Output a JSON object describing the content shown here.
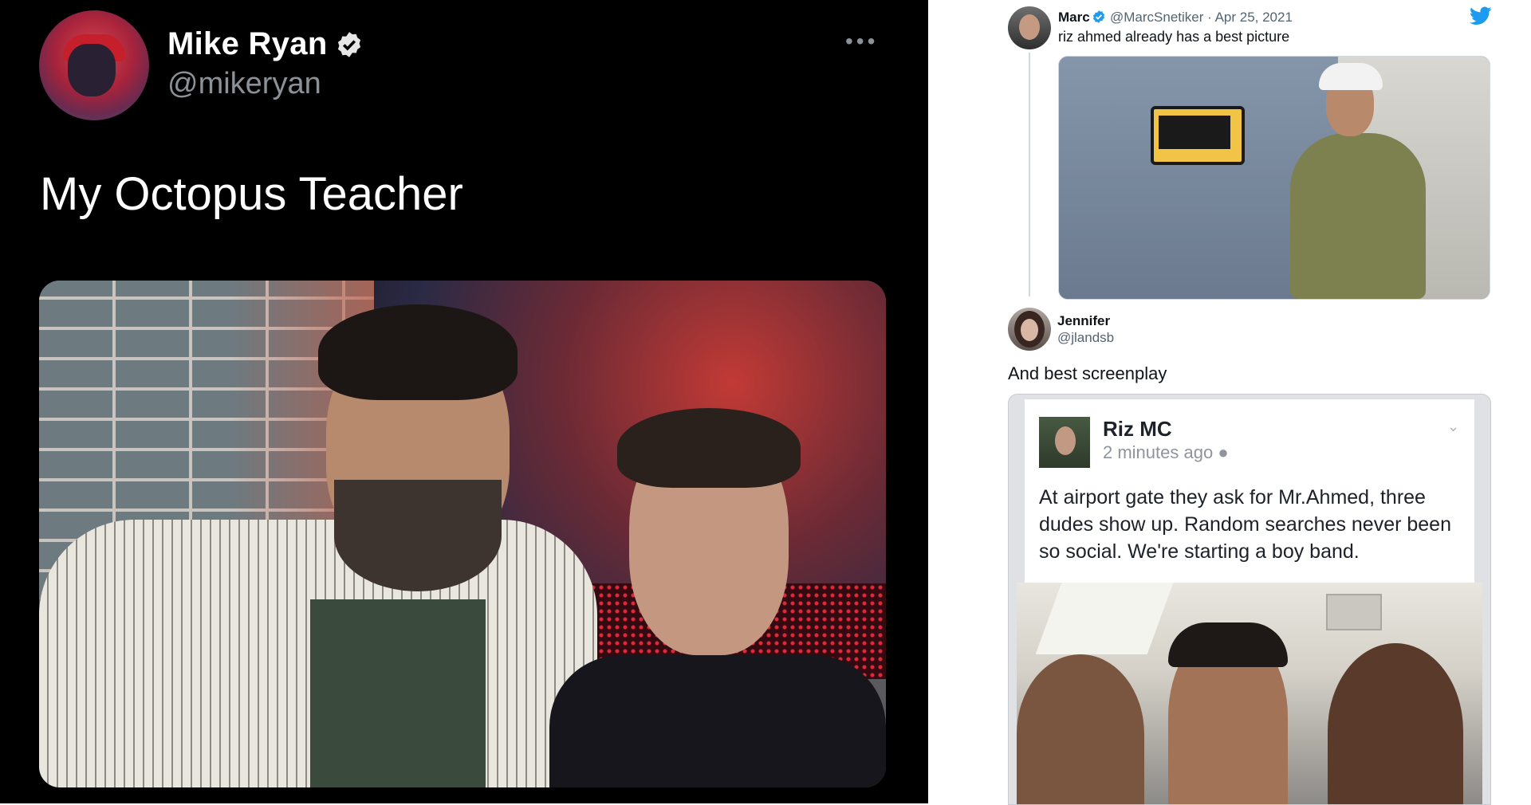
{
  "left_tweet": {
    "author_name": "Mike Ryan",
    "handle": "@mikeryan",
    "more": "•••",
    "text": "My Octopus Teacher"
  },
  "right_thread": {
    "tweet1": {
      "author_name": "Marc",
      "handle_date": "@MarcSnetiker · Apr 25, 2021",
      "text": "riz ahmed already has a best picture"
    },
    "reply": {
      "author_name": "Jennifer",
      "handle": "@jlandsb",
      "text": "And best screenplay"
    },
    "embedded_post": {
      "author": "Riz MC",
      "time": "2 minutes ago",
      "text": "At airport gate they ask for Mr.Ahmed, three dudes show up. Random searches never been so social. We're starting a boy band."
    }
  },
  "colors": {
    "left_bg": "#000000",
    "twitter_blue": "#1d9bf0"
  }
}
